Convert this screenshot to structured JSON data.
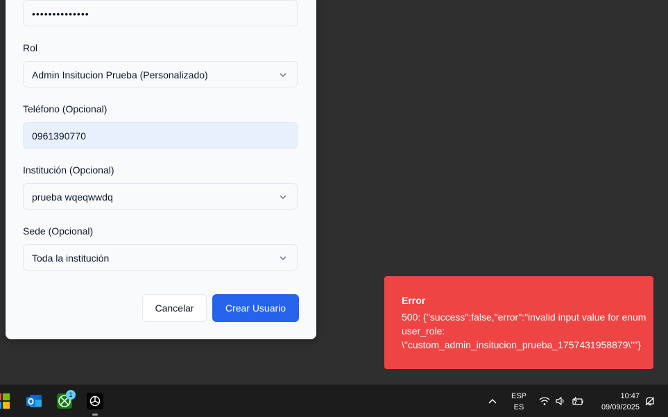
{
  "form": {
    "password_value": "••••••••••••••",
    "role_label": "Rol",
    "role_value": "Admin Insitucion Prueba (Personalizado)",
    "phone_label": "Teléfono (Opcional)",
    "phone_value": "0961390770",
    "institution_label": "Institución (Opcional)",
    "institution_value": "prueba wqeqwwdq",
    "site_label": "Sede (Opcional)",
    "site_value": "Toda la institución",
    "cancel_label": "Cancelar",
    "create_label": "Crear Usuario"
  },
  "toast": {
    "title": "Error",
    "message": "500: {\"success\":false,\"error\":\"invalid input value for enum user_role: \\\"custom_admin_insitucion_prueba_1757431958879\\\"\"}",
    "color": "#ef4444"
  },
  "taskbar": {
    "language_top": "ESP",
    "language_bottom": "ES",
    "time": "10:47",
    "date": "09/09/2025",
    "xbox_badge": "1",
    "icons": [
      "windows-start-icon",
      "outlook-icon",
      "xbox-icon",
      "chatgpt-icon",
      "chevron-up-icon",
      "wifi-icon",
      "volume-icon",
      "battery-icon",
      "notification-icon"
    ]
  },
  "colors": {
    "primary_button": "#2563eb",
    "error_toast": "#ef4444",
    "backdrop": "#2f2f2f"
  }
}
